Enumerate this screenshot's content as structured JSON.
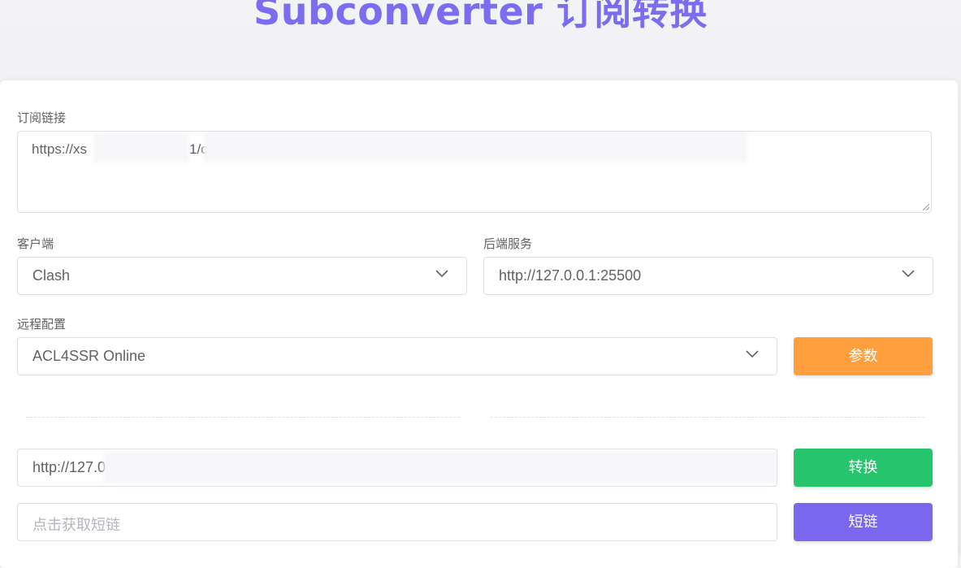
{
  "page": {
    "title": "Subconverter 订阅转换"
  },
  "subscription": {
    "label": "订阅链接",
    "value_visible_prefix": "https://xs",
    "value_visible_mid": "1/c"
  },
  "client": {
    "label": "客户端",
    "selected": "Clash"
  },
  "backend": {
    "label": "后端服务",
    "selected": "http://127.0.0.1:25500"
  },
  "remote_config": {
    "label": "远程配置",
    "selected": "ACL4SSR Online"
  },
  "buttons": {
    "params": "参数",
    "convert": "转换",
    "short_link": "短链"
  },
  "result": {
    "value_visible_prefix": "http://127.0"
  },
  "short_link_input": {
    "placeholder": "点击获取短链"
  },
  "colors": {
    "title": "#7b6cf0",
    "params_button": "#fe9e3c",
    "convert_button": "#27c46e",
    "short_link_button": "#7a67ee"
  },
  "icons": {
    "dropdown": "chevron-down-icon"
  }
}
